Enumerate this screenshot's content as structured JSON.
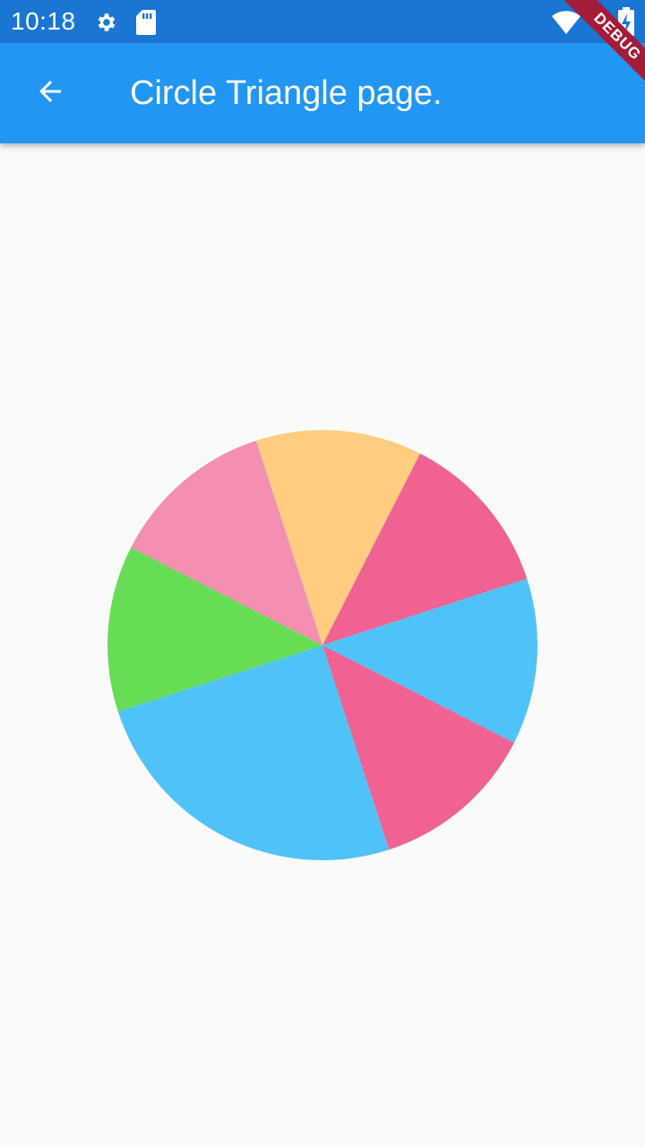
{
  "status_bar": {
    "time": "10:18",
    "icons": [
      "gear-icon",
      "sd-card-icon",
      "wifi-icon",
      "battery-charging-icon"
    ]
  },
  "app_bar": {
    "title": "Circle Triangle page.",
    "back_icon": "arrow-back-icon",
    "color": "#2196F3"
  },
  "debug_banner": {
    "label": "DEBUG",
    "color": "#A41C38"
  },
  "wheel": {
    "segments": [
      {
        "color": "#FFCC80",
        "portion": 0.125
      },
      {
        "color": "#F06292",
        "portion": 0.125
      },
      {
        "color": "#4FC3F7",
        "portion": 0.125
      },
      {
        "color": "#F06292",
        "portion": 0.125
      },
      {
        "color": "#4FC3F7",
        "portion": 0.25
      },
      {
        "color": "#66DD55",
        "portion": 0.125
      },
      {
        "color": "#F48FB1",
        "portion": 0.125
      }
    ],
    "background": "#FAFAFA"
  }
}
